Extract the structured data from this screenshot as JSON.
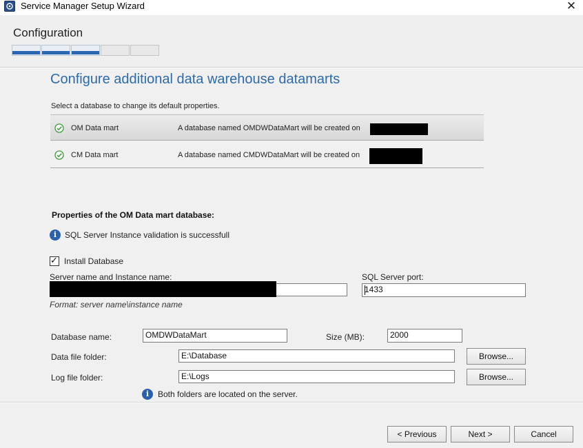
{
  "window": {
    "title": "Service Manager Setup Wizard",
    "close_glyph": "✕",
    "icon": "setup-wizard-icon"
  },
  "header": {
    "stage": "Configuration",
    "progress": {
      "completed_steps": 3,
      "total_steps": 5
    }
  },
  "page": {
    "title": "Configure additional data warehouse datamarts",
    "hint": "Select a database to change its default properties."
  },
  "datamarts": [
    {
      "name": "OM Data mart",
      "description": "A database named OMDWDataMart will be created on",
      "selected": true,
      "status_icon": "check-circle-icon"
    },
    {
      "name": "CM Data mart",
      "description": "A database named CMDWDataMart will be created on",
      "selected": false,
      "status_icon": "check-circle-icon"
    }
  ],
  "properties": {
    "title": "Properties of the OM Data mart database:",
    "validation_message": "SQL Server Instance validation is successfull",
    "install_database": {
      "label": "Install Database",
      "checked": true,
      "check_glyph": "✓"
    },
    "server_instance": {
      "label": "Server name and Instance name:",
      "value": "",
      "format_hint": "Format: server name\\instance name"
    },
    "sql_port": {
      "label": "SQL Server port:",
      "value": "1433"
    },
    "database_name": {
      "label": "Database name:",
      "value": "OMDWDataMart"
    },
    "size": {
      "label": "Size (MB):",
      "value": "2000"
    },
    "data_folder": {
      "label": "Data file folder:",
      "value": "E:\\Database",
      "browse_label": "Browse..."
    },
    "log_folder": {
      "label": "Log file folder:",
      "value": "E:\\Logs",
      "browse_label": "Browse..."
    },
    "folders_note": "Both folders are located on the  server.",
    "info_glyph": "i"
  },
  "footer": {
    "previous_label": "< Previous",
    "next_label": "Next >",
    "cancel_label": "Cancel"
  },
  "colors": {
    "accent": "#2d6aa8",
    "progress_fill": "#2b67b0",
    "info": "#2c5fae",
    "check": "#3d9a3d"
  }
}
